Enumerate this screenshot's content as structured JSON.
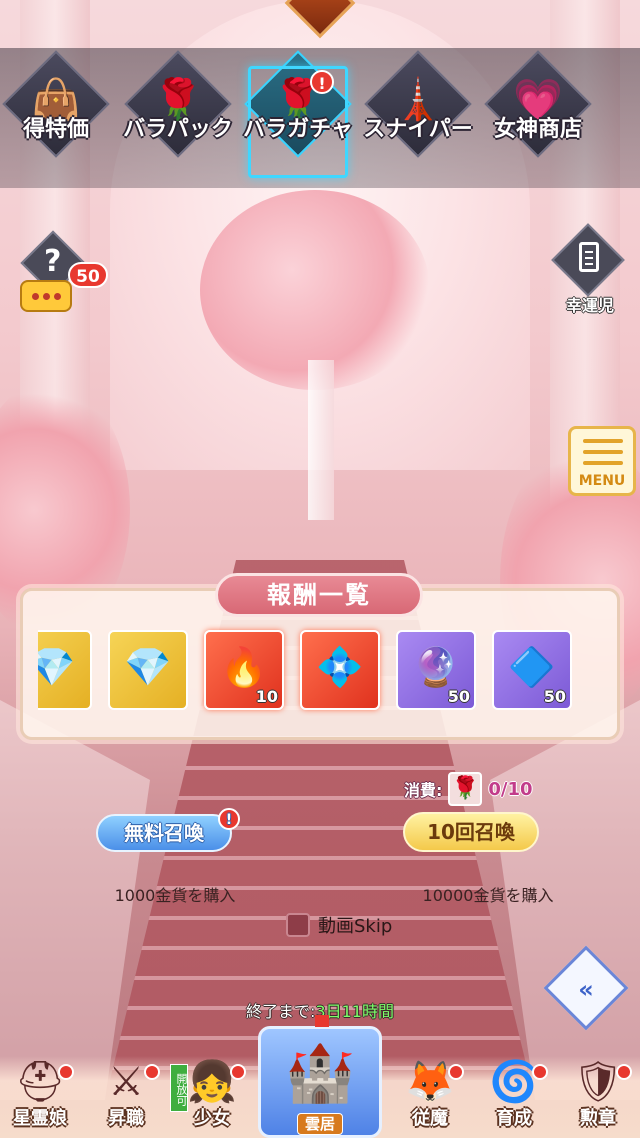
{
  "tabs": [
    {
      "label": "得特価",
      "icon": "gift-bag-icon",
      "glyph": "👜",
      "active": false
    },
    {
      "label": "バラパック",
      "icon": "rose-bouquet-icon",
      "glyph": "🌹",
      "active": false
    },
    {
      "label": "バラガチャ",
      "icon": "rose-icon",
      "glyph": "🌹",
      "active": true,
      "alert": "!"
    },
    {
      "label": "スナイパー",
      "icon": "sniper-tower-icon",
      "glyph": "🗼",
      "active": false
    },
    {
      "label": "女神商店",
      "icon": "shop-heart-icon",
      "glyph": "💗",
      "active": false
    }
  ],
  "chat": {
    "count": "50"
  },
  "lucky": {
    "label": "幸運児"
  },
  "menu": {
    "label": "MENU"
  },
  "rewards": {
    "title": "報酬一覧",
    "items": [
      {
        "icon": "gem-pile-icon",
        "glyph": "💎",
        "style": "gold",
        "qty": ""
      },
      {
        "icon": "diamond-pile-icon",
        "glyph": "💎",
        "style": "gold",
        "qty": ""
      },
      {
        "icon": "fire-stone-icon",
        "glyph": "🔥",
        "style": "red",
        "qty": "10"
      },
      {
        "icon": "blue-crystal-icon",
        "glyph": "💠",
        "style": "red",
        "qty": ""
      },
      {
        "icon": "crystal-ball-icon",
        "glyph": "🔮",
        "style": "purple",
        "qty": "50"
      },
      {
        "icon": "purple-crystal-icon",
        "glyph": "🔷",
        "style": "purple",
        "qty": "50"
      }
    ]
  },
  "cost": {
    "label": "消費:",
    "value": "0/10"
  },
  "buttons": {
    "free_label": "無料召喚",
    "ten_label": "10回召喚",
    "free_price": "1000金貨を購入",
    "ten_price": "10000金貨を購入"
  },
  "skip": {
    "label": "動画Skip"
  },
  "timer": {
    "prefix": "終了まで:",
    "value": "3日11時間"
  },
  "nav": {
    "items": [
      {
        "label": "星霊娘",
        "icon": "knight-helmet-icon",
        "glyph": "⛑"
      },
      {
        "label": "昇職",
        "icon": "crossed-swords-icon",
        "glyph": "⚔"
      },
      {
        "label": "少女",
        "icon": "girl-portrait-icon",
        "glyph": "👧"
      },
      {
        "label": "雲居",
        "icon": "castle-icon",
        "glyph": "🏰"
      },
      {
        "label": "従魔",
        "icon": "fox-mask-icon",
        "glyph": "🦊"
      },
      {
        "label": "育成",
        "icon": "portal-icon",
        "glyph": "🌀"
      },
      {
        "label": "勲章",
        "icon": "medal-shield-icon",
        "glyph": "🛡"
      }
    ],
    "open_badge": "開放可"
  }
}
